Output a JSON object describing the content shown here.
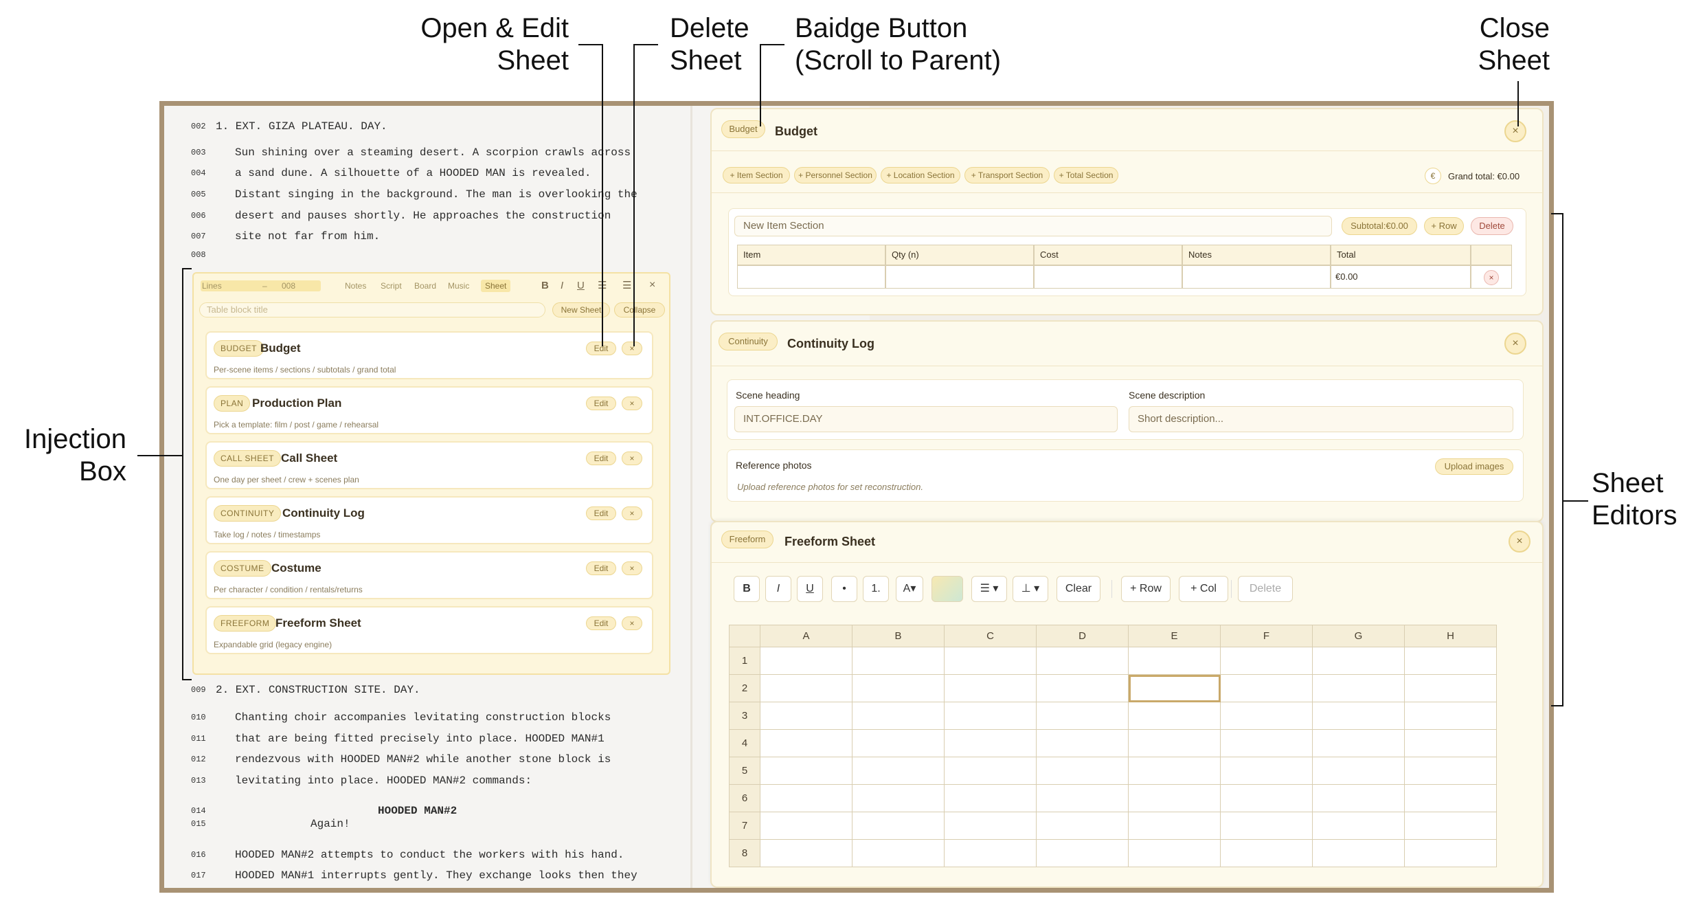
{
  "annotations": {
    "open_edit": [
      "Open & Edit",
      "Sheet"
    ],
    "delete": [
      "Delete",
      "Sheet"
    ],
    "badge": [
      "Baidge Button",
      "(Scroll to Parent)"
    ],
    "close": [
      "Close",
      "Sheet"
    ],
    "injection": [
      "Injection",
      "Box"
    ],
    "editors": [
      "Sheet",
      "Editors"
    ]
  },
  "script": {
    "lines_top": [
      {
        "num": "002",
        "text": "1. EXT. GIZA PLATEAU. DAY."
      },
      {
        "num": "003",
        "text": "Sun shining over a steaming desert. A scorpion crawls across"
      },
      {
        "num": "004",
        "text": "a sand dune. A silhouette of a HOODED MAN is revealed."
      },
      {
        "num": "005",
        "text": "Distant singing in the background. The man is overlooking the"
      },
      {
        "num": "006",
        "text": "desert and pauses shortly. He approaches the construction"
      },
      {
        "num": "007",
        "text": "site not far from him."
      },
      {
        "num": "008",
        "text": ""
      }
    ],
    "lines_bottom": [
      {
        "num": "009",
        "text": "2. EXT. CONSTRUCTION SITE. DAY."
      },
      {
        "num": "010",
        "text": "Chanting choir accompanies levitating construction blocks"
      },
      {
        "num": "011",
        "text": "that are being fitted precisely into place. HOODED MAN#1"
      },
      {
        "num": "012",
        "text": "rendezvous with HOODED MAN#2 while another stone block is"
      },
      {
        "num": "013",
        "text": "levitating into place. HOODED MAN#2 commands:"
      },
      {
        "num": "014",
        "text": "HOODED MAN#2"
      },
      {
        "num": "015",
        "text": "Again!"
      },
      {
        "num": "016",
        "text": "HOODED MAN#2 attempts to conduct the workers with his hand."
      },
      {
        "num": "017",
        "text": "HOODED MAN#1 interrupts gently. They exchange looks then they"
      }
    ]
  },
  "injection": {
    "lines_label": "Lines",
    "lines_dash": "–",
    "lines_to": "008",
    "tabs": [
      "Notes",
      "Script",
      "Board",
      "Music",
      "Sheet"
    ],
    "format": {
      "bold": "B",
      "italic": "I",
      "underline": "U",
      "bullets": "☷",
      "numbers": "☰",
      "close": "×"
    },
    "title_placeholder": "Table block title",
    "new_sheet": "New Sheet",
    "collapse": "Collapse",
    "sheets": [
      {
        "tag": "BUDGET",
        "title": "Budget",
        "desc": "Per-scene items / sections / subtotals / grand total"
      },
      {
        "tag": "PLAN",
        "title": "Production Plan",
        "desc": "Pick a template: film / post / game / rehearsal"
      },
      {
        "tag": "CALL SHEET",
        "title": "Call Sheet",
        "desc": "One day per sheet / crew + scenes plan"
      },
      {
        "tag": "CONTINUITY",
        "title": "Continuity Log",
        "desc": "Take log / notes / timestamps"
      },
      {
        "tag": "COSTUME",
        "title": "Costume",
        "desc": "Per character / condition / rentals/returns"
      },
      {
        "tag": "FREEFORM",
        "title": "Freeform Sheet",
        "desc": "Expandable grid (legacy engine)"
      }
    ],
    "edit_label": "Edit",
    "delete_label": "×"
  },
  "budget": {
    "badge": "Budget",
    "title": "Budget",
    "close": "×",
    "sections": [
      "+ Item Section",
      "+ Personnel Section",
      "+ Location Section",
      "+ Transport Section",
      "+ Total Section"
    ],
    "currency": "€",
    "grand_total": "Grand total: €0.00",
    "section_name": "New Item Section",
    "subtotal": "Subtotal:€0.00",
    "add_row": "+ Row",
    "delete": "Delete",
    "columns": [
      "Item",
      "Qty (n)",
      "Cost",
      "Notes",
      "Total"
    ],
    "row_total": "€0.00",
    "row_delete": "×"
  },
  "continuity": {
    "badge": "Continuity",
    "title": "Continuity Log",
    "close": "×",
    "heading_label": "Scene heading",
    "heading_value": "INT.OFFICE.DAY",
    "desc_label": "Scene description",
    "desc_placeholder": "Short description...",
    "photos_label": "Reference photos",
    "photos_hint": "Upload reference photos for set reconstruction.",
    "upload": "Upload images"
  },
  "freeform": {
    "badge": "Freeform",
    "title": "Freeform Sheet",
    "close": "×",
    "toolbar": {
      "bold": "B",
      "italic": "I",
      "underline": "U",
      "bullet": "•",
      "number": "1.",
      "font": "A▾",
      "align": "☰ ▾",
      "valign": "⊥ ▾",
      "clear": "Clear",
      "row": "+ Row",
      "col": "+ Col",
      "delete": "Delete"
    },
    "columns": [
      "A",
      "B",
      "C",
      "D",
      "E",
      "F",
      "G",
      "H"
    ],
    "rows": [
      "1",
      "2",
      "3",
      "4",
      "5",
      "6",
      "7",
      "8"
    ]
  },
  "colors": {
    "accent": "#fbeec6",
    "frame": "#a89274",
    "selected_cell": "#c9a96a"
  }
}
